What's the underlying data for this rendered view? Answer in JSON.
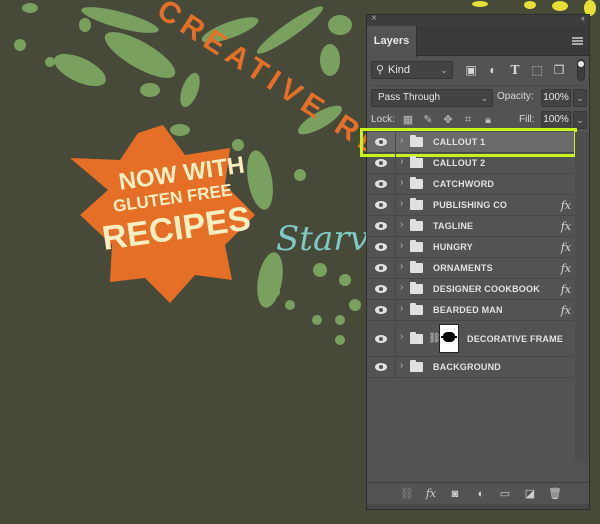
{
  "artwork": {
    "arc_text": "CREATIVE RE",
    "callout_lines": [
      "NOW WITH",
      "GLUTEN FREE",
      "RECIPES"
    ],
    "script_text": "Starv",
    "colors": {
      "background": "#484a39",
      "splatter": "#7aa060",
      "orange": "#e56f26",
      "cream": "#f7efc1",
      "teal": "#7ec9c3",
      "yellow": "#e6df3a"
    }
  },
  "panel": {
    "tab_label": "Layers",
    "close_icon": "×",
    "collapse_icon": "‹‹",
    "filter": {
      "kind_label": "Kind",
      "icons": [
        "image-filter-icon",
        "adjustment-filter-icon",
        "type-filter-icon",
        "shape-filter-icon",
        "smart-object-filter-icon"
      ]
    },
    "blend_mode": "Pass Through",
    "opacity_label": "Opacity:",
    "opacity_value": "100%",
    "lock_label": "Lock:",
    "fill_label": "Fill:",
    "fill_value": "100%",
    "layers": [
      {
        "name": "CALLOUT 1",
        "fx": false,
        "selected": true
      },
      {
        "name": "CALLOUT 2",
        "fx": false
      },
      {
        "name": "CATCHWORD",
        "fx": false
      },
      {
        "name": "PUBLISHING CO",
        "fx": true
      },
      {
        "name": "TAGLINE",
        "fx": true
      },
      {
        "name": "HUNGRY",
        "fx": true
      },
      {
        "name": "ORNAMENTS",
        "fx": true
      },
      {
        "name": "DESIGNER COOKBOOK",
        "fx": true
      },
      {
        "name": "BEARDED MAN",
        "fx": true
      },
      {
        "name": "DECORATIVE FRAME",
        "fx": false,
        "mask": true
      },
      {
        "name": "BACKGROUND",
        "fx": false
      }
    ],
    "fx_label": "fx",
    "highlight_color": "#c9f31d",
    "footer_icons": [
      "link-layers-icon",
      "fx-icon",
      "add-mask-icon",
      "adjustment-layer-icon",
      "new-group-icon",
      "new-layer-icon",
      "delete-icon"
    ]
  }
}
